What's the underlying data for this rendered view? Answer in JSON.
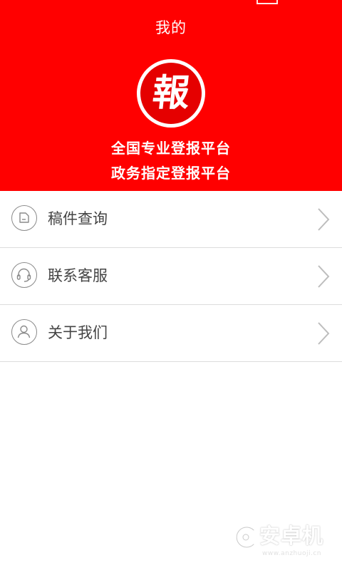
{
  "header": {
    "title": "我的",
    "logo_char": "報",
    "slogan_1": "全国专业登报平台",
    "slogan_2": "政务指定登报平台",
    "background_color": "#ff0000"
  },
  "menu": {
    "items": [
      {
        "label": "稿件查询",
        "icon": "document-icon"
      },
      {
        "label": "联系客服",
        "icon": "headset-icon"
      },
      {
        "label": "关于我们",
        "icon": "user-icon"
      }
    ]
  },
  "watermark": {
    "text": "安卓机",
    "url": "www.anzhuoji.cn"
  }
}
